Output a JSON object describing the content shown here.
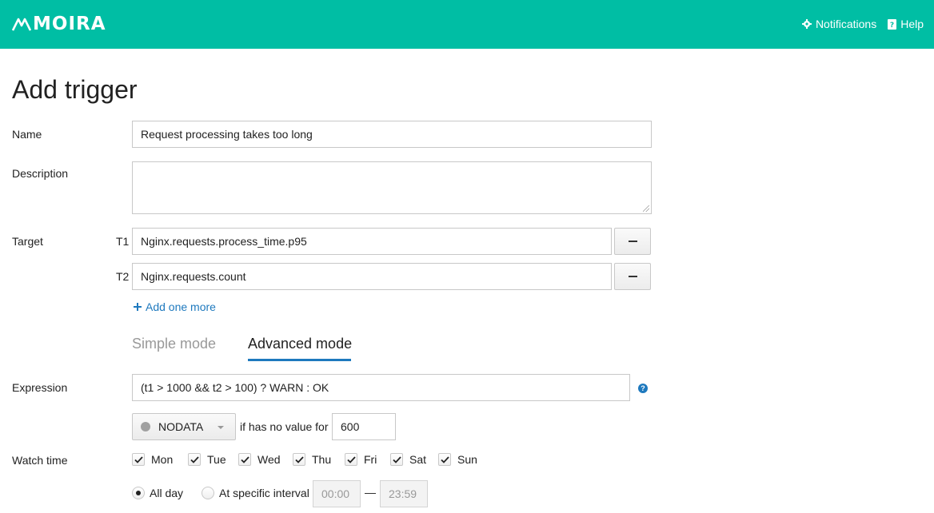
{
  "app": {
    "logo_text": "MOIRA",
    "brand_color": "#00bea4",
    "nav": [
      {
        "label": "Notifications",
        "icon": "gear-icon"
      },
      {
        "label": "Help",
        "icon": "help-book-icon"
      }
    ]
  },
  "page": {
    "title": "Add trigger"
  },
  "form": {
    "name": {
      "label": "Name",
      "value": "Request processing takes too long"
    },
    "description": {
      "label": "Description",
      "value": ""
    },
    "target": {
      "label": "Target",
      "items": [
        {
          "tag": "T1",
          "value": "Nginx.requests.process_time.p95"
        },
        {
          "tag": "T2",
          "value": "Nginx.requests.count"
        }
      ],
      "add_more": "Add one more"
    },
    "modes": {
      "simple": "Simple mode",
      "advanced": "Advanced mode",
      "active": "Advanced mode"
    },
    "expression": {
      "label": "Expression",
      "value": "(t1 > 1000 && t2 > 100) ? WARN : OK",
      "help_icon": "?"
    },
    "nodata": {
      "state": "NODATA",
      "text": "if has no value for",
      "value": "600"
    },
    "watch_time": {
      "label": "Watch time",
      "days": [
        {
          "label": "Mon",
          "checked": true
        },
        {
          "label": "Tue",
          "checked": true
        },
        {
          "label": "Wed",
          "checked": true
        },
        {
          "label": "Thu",
          "checked": true
        },
        {
          "label": "Fri",
          "checked": true
        },
        {
          "label": "Sat",
          "checked": true
        },
        {
          "label": "Sun",
          "checked": true
        }
      ],
      "all_day": {
        "label": "All day",
        "selected": true
      },
      "interval": {
        "label": "At specific interval",
        "selected": false,
        "from": "00:00",
        "to": "23:59",
        "separator": "—"
      }
    }
  }
}
